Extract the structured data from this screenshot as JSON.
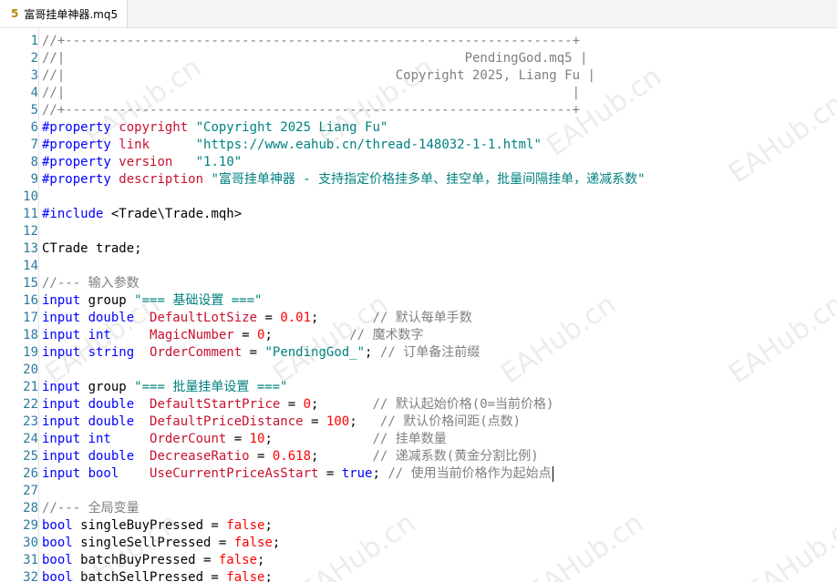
{
  "tab": {
    "icon": "5",
    "title": "富哥挂单神器.mq5"
  },
  "watermark": "EAHub.cn",
  "lines": [
    {
      "n": "1",
      "parts": [
        [
          "cm",
          "//+------------------------------------------------------------------+"
        ]
      ]
    },
    {
      "n": "2",
      "parts": [
        [
          "cm",
          "//|                                                    PendingGod.mq5 |"
        ]
      ]
    },
    {
      "n": "3",
      "parts": [
        [
          "cm",
          "//|                                           Copyright 2025, Liang Fu |"
        ]
      ]
    },
    {
      "n": "4",
      "parts": [
        [
          "cm",
          "//|                                                                  |"
        ]
      ]
    },
    {
      "n": "5",
      "parts": [
        [
          "cm",
          "//+------------------------------------------------------------------+"
        ]
      ]
    },
    {
      "n": "6",
      "parts": [
        [
          "prop",
          "#property "
        ],
        [
          "var",
          "copyright"
        ],
        [
          "t",
          " "
        ],
        [
          "str",
          "\"Copyright 2025 Liang Fu\""
        ]
      ]
    },
    {
      "n": "7",
      "parts": [
        [
          "prop",
          "#property "
        ],
        [
          "var",
          "link"
        ],
        [
          "t",
          "      "
        ],
        [
          "str",
          "\"https://www.eahub.cn/thread-148032-1-1.html\""
        ]
      ]
    },
    {
      "n": "8",
      "parts": [
        [
          "prop",
          "#property "
        ],
        [
          "var",
          "version"
        ],
        [
          "t",
          "   "
        ],
        [
          "str",
          "\"1.10\""
        ]
      ]
    },
    {
      "n": "9",
      "parts": [
        [
          "prop",
          "#property "
        ],
        [
          "var",
          "description"
        ],
        [
          "t",
          " "
        ],
        [
          "str",
          "\"富哥挂单神器 - 支持指定价格挂多单、挂空单，批量间隔挂单，递减系数\""
        ]
      ]
    },
    {
      "n": "10",
      "parts": []
    },
    {
      "n": "11",
      "parts": [
        [
          "prop",
          "#include"
        ],
        [
          "t",
          " <Trade\\Trade.mqh>"
        ]
      ]
    },
    {
      "n": "12",
      "parts": []
    },
    {
      "n": "13",
      "parts": [
        [
          "t",
          "CTrade trade;"
        ]
      ]
    },
    {
      "n": "14",
      "parts": []
    },
    {
      "n": "15",
      "parts": [
        [
          "cm",
          "//--- 输入参数"
        ]
      ]
    },
    {
      "n": "16",
      "parts": [
        [
          "kw",
          "input"
        ],
        [
          "t",
          " group "
        ],
        [
          "str",
          "\"=== 基础设置 ===\""
        ]
      ]
    },
    {
      "n": "17",
      "parts": [
        [
          "kw",
          "input double"
        ],
        [
          "t",
          "  "
        ],
        [
          "var",
          "DefaultLotSize"
        ],
        [
          "t",
          " = "
        ],
        [
          "num",
          "0.01"
        ],
        [
          "t",
          ";       "
        ],
        [
          "cm",
          "// 默认每单手数"
        ]
      ]
    },
    {
      "n": "18",
      "parts": [
        [
          "kw",
          "input int"
        ],
        [
          "t",
          "     "
        ],
        [
          "var",
          "MagicNumber"
        ],
        [
          "t",
          " = "
        ],
        [
          "num",
          "0"
        ],
        [
          "t",
          ";          "
        ],
        [
          "cm",
          "// 魔术数字"
        ]
      ]
    },
    {
      "n": "19",
      "parts": [
        [
          "kw",
          "input string"
        ],
        [
          "t",
          "  "
        ],
        [
          "var",
          "OrderComment"
        ],
        [
          "t",
          " = "
        ],
        [
          "str",
          "\"PendingGod_\""
        ],
        [
          "t",
          "; "
        ],
        [
          "cm",
          "// 订单备注前缀"
        ]
      ]
    },
    {
      "n": "20",
      "parts": []
    },
    {
      "n": "21",
      "parts": [
        [
          "kw",
          "input"
        ],
        [
          "t",
          " group "
        ],
        [
          "str",
          "\"=== 批量挂单设置 ===\""
        ]
      ]
    },
    {
      "n": "22",
      "parts": [
        [
          "kw",
          "input double"
        ],
        [
          "t",
          "  "
        ],
        [
          "var",
          "DefaultStartPrice"
        ],
        [
          "t",
          " = "
        ],
        [
          "num",
          "0"
        ],
        [
          "t",
          ";       "
        ],
        [
          "cm",
          "// 默认起始价格(0=当前价格)"
        ]
      ]
    },
    {
      "n": "23",
      "parts": [
        [
          "kw",
          "input double"
        ],
        [
          "t",
          "  "
        ],
        [
          "var",
          "DefaultPriceDistance"
        ],
        [
          "t",
          " = "
        ],
        [
          "num",
          "100"
        ],
        [
          "t",
          ";   "
        ],
        [
          "cm",
          "// 默认价格间距(点数)"
        ]
      ]
    },
    {
      "n": "24",
      "parts": [
        [
          "kw",
          "input int"
        ],
        [
          "t",
          "     "
        ],
        [
          "var",
          "OrderCount"
        ],
        [
          "t",
          " = "
        ],
        [
          "num",
          "10"
        ],
        [
          "t",
          ";             "
        ],
        [
          "cm",
          "// 挂单数量"
        ]
      ]
    },
    {
      "n": "25",
      "parts": [
        [
          "kw",
          "input double"
        ],
        [
          "t",
          "  "
        ],
        [
          "var",
          "DecreaseRatio"
        ],
        [
          "t",
          " = "
        ],
        [
          "num",
          "0.618"
        ],
        [
          "t",
          ";       "
        ],
        [
          "cm",
          "// 递减系数(黄金分割比例)"
        ]
      ]
    },
    {
      "n": "26",
      "parts": [
        [
          "kw",
          "input bool"
        ],
        [
          "t",
          "    "
        ],
        [
          "var",
          "UseCurrentPriceAsStart"
        ],
        [
          "t",
          " = "
        ],
        [
          "kw",
          "true"
        ],
        [
          "t",
          "; "
        ],
        [
          "cm",
          "// 使用当前价格作为起始点"
        ]
      ],
      "cursor": true
    },
    {
      "n": "27",
      "parts": []
    },
    {
      "n": "28",
      "parts": [
        [
          "cm",
          "//--- 全局变量"
        ]
      ]
    },
    {
      "n": "29",
      "parts": [
        [
          "kw",
          "bool"
        ],
        [
          "t",
          " singleBuyPressed = "
        ],
        [
          "num",
          "false"
        ],
        [
          "t",
          ";"
        ]
      ]
    },
    {
      "n": "30",
      "parts": [
        [
          "kw",
          "bool"
        ],
        [
          "t",
          " singleSellPressed = "
        ],
        [
          "num",
          "false"
        ],
        [
          "t",
          ";"
        ]
      ]
    },
    {
      "n": "31",
      "parts": [
        [
          "kw",
          "bool"
        ],
        [
          "t",
          " batchBuyPressed = "
        ],
        [
          "num",
          "false"
        ],
        [
          "t",
          ";"
        ]
      ]
    },
    {
      "n": "32",
      "parts": [
        [
          "kw",
          "bool"
        ],
        [
          "t",
          " batchSellPressed = "
        ],
        [
          "num",
          "false"
        ],
        [
          "t",
          ";"
        ]
      ]
    }
  ]
}
